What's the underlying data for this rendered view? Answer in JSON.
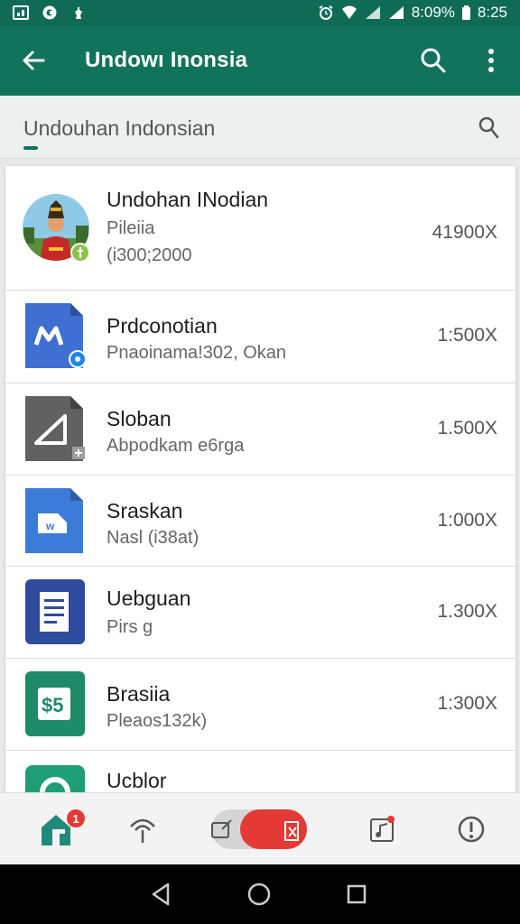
{
  "status_bar": {
    "battery_text": "8:09%",
    "time": "8:25"
  },
  "toolbar": {
    "title": "Undowı Inonsia"
  },
  "subheader": {
    "label": "Undouhan Indonsian"
  },
  "apps": [
    {
      "name": "Undohan INodian",
      "line1": "Pileiia",
      "line2": "(i300;2000",
      "size": "41900X",
      "icon": "portrait-avatar-icon"
    },
    {
      "name": "Prdconotian",
      "line1": "Pnaoinama!302, Okan",
      "size": "1:500X",
      "icon": "docs-m-icon"
    },
    {
      "name": "Sloban",
      "line1": "Abpodkam e6rga",
      "size": "1.500X",
      "icon": "triangle-app-icon"
    },
    {
      "name": "Sraskan",
      "line1": "Nasl (i38at)",
      "size": "1:000X",
      "icon": "doc-w-icon"
    },
    {
      "name": "Uebguan",
      "line1": "Pirs g",
      "size": "1.300X",
      "icon": "notes-icon"
    },
    {
      "name": "Brasiia",
      "line1": "Pleaos132k)",
      "size": "1:300X",
      "icon": "money-icon"
    },
    {
      "name": "Ucblor",
      "line1": "",
      "size": "",
      "icon": "circle-app-icon"
    }
  ],
  "bottom_nav": {
    "badge": "1"
  },
  "colors": {
    "primary": "#12735c",
    "status": "#0f6b55",
    "accent_red": "#e53935"
  }
}
